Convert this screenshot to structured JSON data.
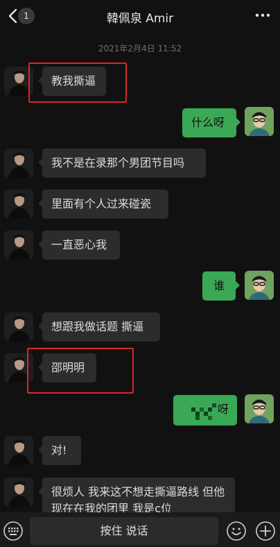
{
  "header": {
    "unread_count": "1",
    "title": "韓佩泉 Amir"
  },
  "timestamp": "2021年2月4日 11:52",
  "messages": [
    {
      "side": "in",
      "text": "教我撕逼",
      "highlighted": true
    },
    {
      "side": "out",
      "text": "什么呀"
    },
    {
      "side": "in",
      "text": "我不是在录那个男团节目吗"
    },
    {
      "side": "in",
      "text": "里面有个人过来碰瓷"
    },
    {
      "side": "in",
      "text": "一直恶心我"
    },
    {
      "side": "out",
      "text": "谁"
    },
    {
      "side": "in",
      "text": "想跟我做话题 撕逼"
    },
    {
      "side": "in",
      "text": "邵明明",
      "highlighted": true
    },
    {
      "side": "out",
      "text": "呀",
      "obscured": true
    },
    {
      "side": "in",
      "text": "对!"
    },
    {
      "side": "in",
      "text": "很烦人 我来这不想走撕逼路线 但他现在在我的团里 我是c位"
    }
  ],
  "input_bar": {
    "hold_to_talk": "按住 说话"
  },
  "colors": {
    "background": "#111111",
    "incoming_bubble": "#2c2c2c",
    "outgoing_bubble": "#3aa855",
    "highlight_box": "#d9262c"
  },
  "icons": [
    "back-chevron-icon",
    "more-dots-icon",
    "keyboard-icon",
    "emoji-icon",
    "plus-icon"
  ]
}
